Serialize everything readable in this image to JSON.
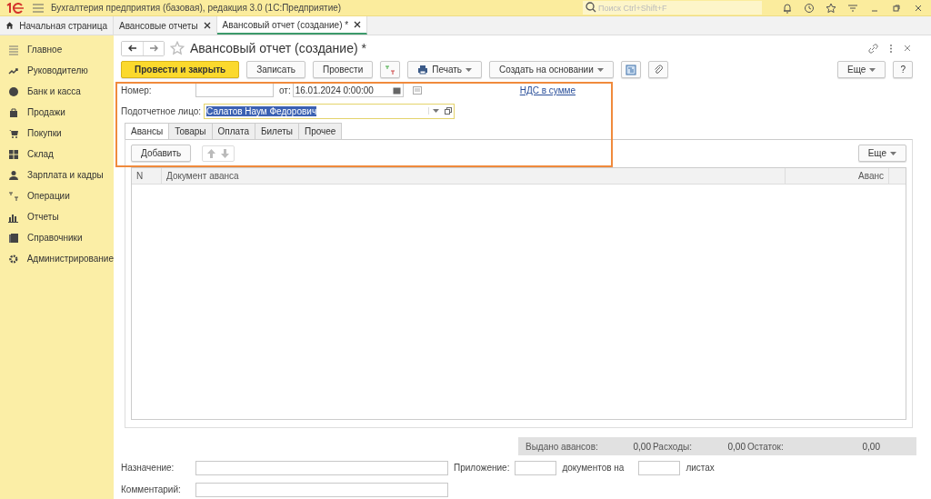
{
  "app": {
    "title": "Бухгалтерия предприятия (базовая), редакция 3.0  (1С:Предприятие)",
    "search_placeholder": "Поиск Ctrl+Shift+F"
  },
  "open_tabs": [
    {
      "label": "Начальная страница",
      "kind": "home",
      "selected": false
    },
    {
      "label": "Авансовые отчеты",
      "kind": "doc",
      "selected": false
    },
    {
      "label": "Авансовый отчет (создание) *",
      "kind": "doc",
      "selected": true
    }
  ],
  "sidebar": {
    "items": [
      "Главное",
      "Руководителю",
      "Банк и касса",
      "Продажи",
      "Покупки",
      "Склад",
      "Зарплата и кадры",
      "Операции",
      "Отчеты",
      "Справочники",
      "Администрирование"
    ]
  },
  "form": {
    "title": "Авансовый отчет (создание) *",
    "toolbar": [
      {
        "kind": "primary",
        "label": "Провести и закрыть"
      },
      {
        "kind": "plain",
        "label": "Записать"
      },
      {
        "kind": "plain",
        "label": "Провести"
      },
      {
        "kind": "dtkt"
      },
      {
        "kind": "print",
        "label": "Печать"
      },
      {
        "kind": "menu",
        "label": "Создать на основании"
      },
      {
        "kind": "structure"
      },
      {
        "kind": "clip"
      }
    ],
    "more": "Еще",
    "help": "?",
    "number_label": "Номер:",
    "date_label": "от:",
    "date_value": "16.01.2024  0:00:00",
    "vat_link": "НДС в сумме",
    "person_label": "Подотчетное лицо:",
    "person_value": "Салатов Наум Федорович",
    "person_highlighted": true,
    "tabs": [
      {
        "label": "Авансы",
        "selected": true
      },
      {
        "label": "Товары",
        "selected": false
      },
      {
        "label": "Оплата",
        "selected": false
      },
      {
        "label": "Билеты",
        "selected": false
      },
      {
        "label": "Прочее",
        "selected": false
      }
    ],
    "add_button": "Добавить",
    "table_more": "Еще",
    "columns": [
      "N",
      "Документ аванса",
      "Аванс"
    ],
    "totals": [
      {
        "label": "Выдано авансов:",
        "value": "0,00"
      },
      {
        "label": "Расходы:",
        "value": "0,00"
      },
      {
        "label": "Остаток:",
        "value": "0,00"
      }
    ],
    "purpose_label": "Назначение:",
    "attachment_label": "Приложение:",
    "documents_label": "документов на",
    "sheets_label": "листах",
    "comment_label": "Комментарий:",
    "highlight_frame": true
  }
}
